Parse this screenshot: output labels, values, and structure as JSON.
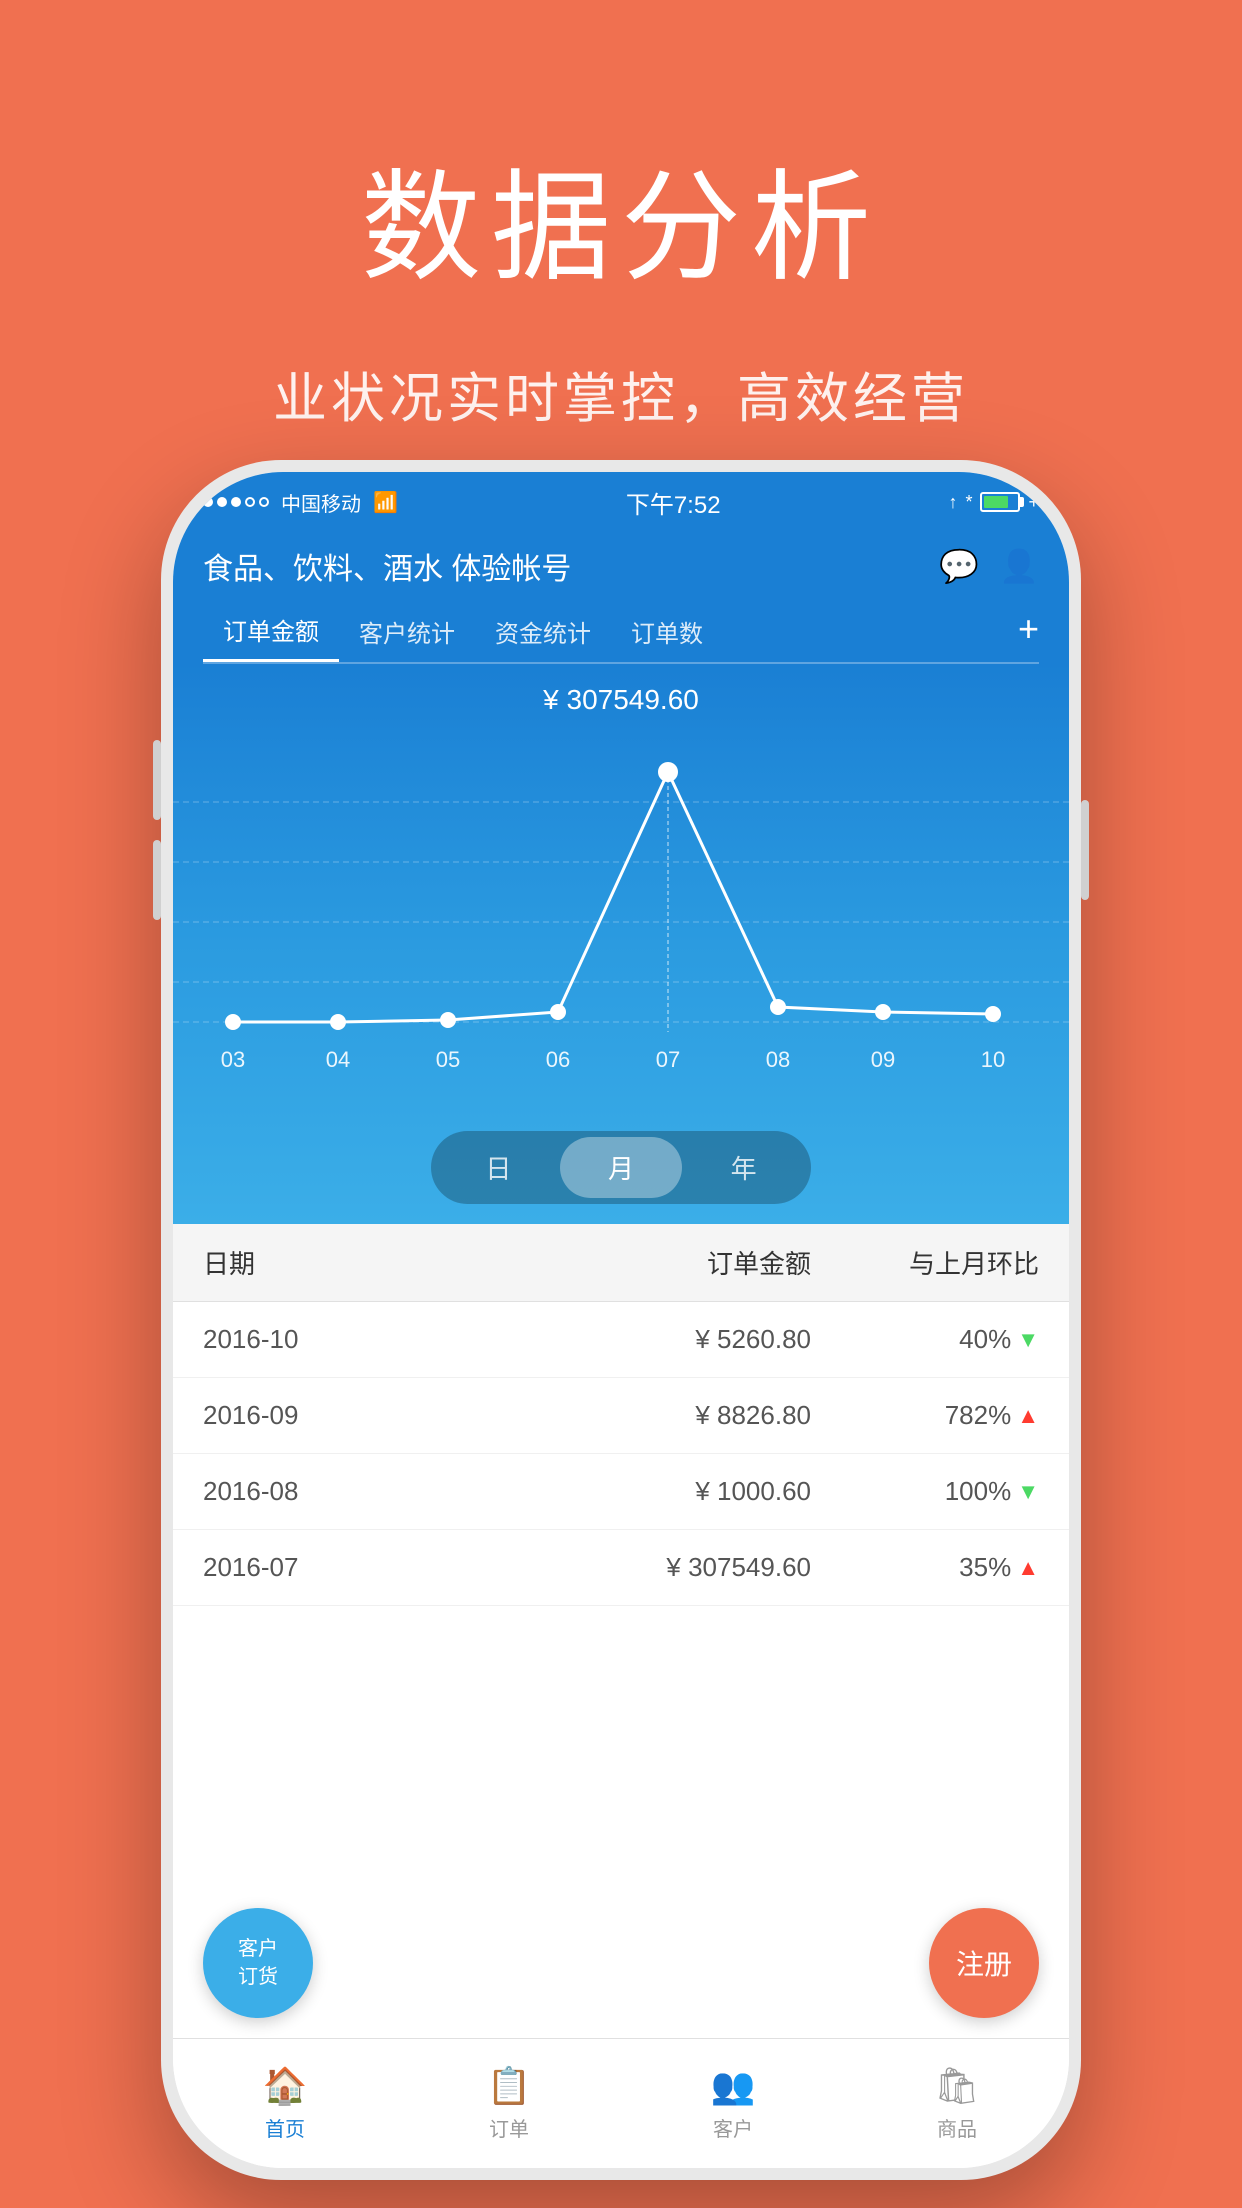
{
  "hero": {
    "title": "数据分析",
    "subtitle": "业状况实时掌控，高效经营"
  },
  "status_bar": {
    "carrier": "中国移动",
    "time": "下午7:52",
    "signal": "●●●○○"
  },
  "app": {
    "title": "食品、饮料、酒水 体验帐号",
    "tabs": [
      "订单金额",
      "客户统计",
      "资金统计",
      "订单数"
    ],
    "active_tab": "订单金额"
  },
  "chart": {
    "value_label": "¥ 307549.60",
    "x_labels": [
      "03",
      "04",
      "05",
      "06",
      "07",
      "08",
      "09",
      "10"
    ],
    "toggle_options": [
      "日",
      "月",
      "年"
    ],
    "active_toggle": "月"
  },
  "table": {
    "headers": [
      "日期",
      "订单金额",
      "与上月环比"
    ],
    "rows": [
      {
        "date": "2016-10",
        "amount": "¥ 5260.80",
        "change": "40%",
        "direction": "down"
      },
      {
        "date": "2016-09",
        "amount": "¥ 8826.80",
        "change": "782%",
        "direction": "up"
      },
      {
        "date": "2016-08",
        "amount": "¥ 1000.60",
        "change": "100%",
        "direction": "down"
      },
      {
        "date": "2016-07",
        "amount": "¥ 307549.60",
        "change": "35%",
        "direction": "up"
      }
    ]
  },
  "bottom_nav": {
    "items": [
      "首页",
      "订单",
      "客户",
      "商品"
    ],
    "active": "首页"
  },
  "float_buttons": {
    "customer": "客户\n订货",
    "register": "注册"
  },
  "colors": {
    "primary": "#1A7FD4",
    "accent": "#F07050",
    "green": "#4CD964",
    "red": "#FF3B30"
  }
}
